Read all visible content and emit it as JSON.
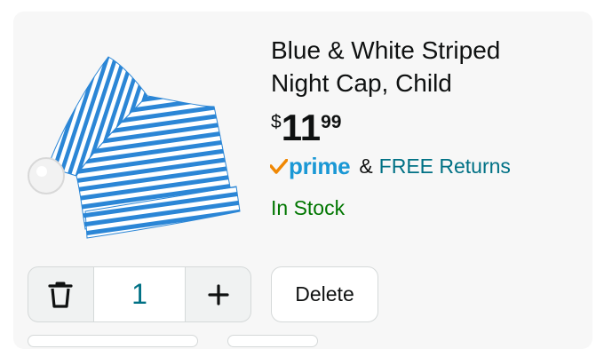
{
  "product": {
    "title_line1": "Blue & White Striped",
    "title_line2": "Night Cap, Child",
    "image_alt": "Blue and white striped night cap with pom-pom",
    "price": {
      "currency": "$",
      "whole": "11",
      "fraction": "99"
    },
    "prime_word": "prime",
    "shipping_amp": "&",
    "shipping_text": "FREE Returns",
    "stock": "In Stock"
  },
  "quantity": {
    "value": "1",
    "decrease_icon": "trash-icon",
    "increase_icon": "plus-icon"
  },
  "actions": {
    "delete_label": "Delete"
  },
  "colors": {
    "price": "#0f1111",
    "prime_blue": "#1a98d5",
    "prime_check": "#f08804",
    "link": "#007185",
    "in_stock": "#007600",
    "stripe_blue": "#2b86d6"
  }
}
